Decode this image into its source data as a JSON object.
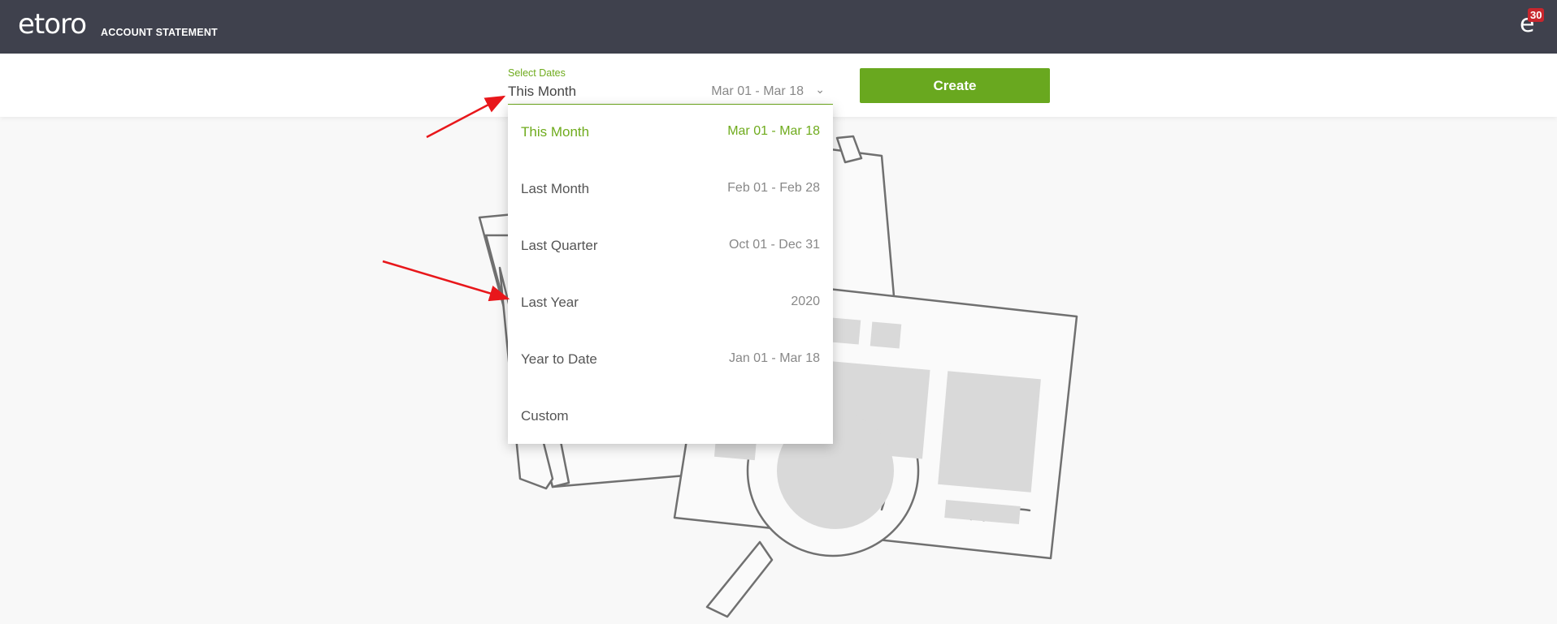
{
  "header": {
    "logo_text": "etoro",
    "title": "ACCOUNT STATEMENT",
    "notification_count": "30",
    "user_avatar_glyph": "e"
  },
  "date_filter": {
    "label": "Select Dates",
    "selected_value": "This Month",
    "selected_range": "Mar 01 - Mar 18",
    "chevron": "⌄"
  },
  "create_button": {
    "label": "Create"
  },
  "dropdown": {
    "options": [
      {
        "label": "This Month",
        "range": "Mar 01 - Mar 18",
        "selected": true
      },
      {
        "label": "Last Month",
        "range": "Feb 01 - Feb 28",
        "selected": false
      },
      {
        "label": "Last Quarter",
        "range": "Oct 01 - Dec 31",
        "selected": false
      },
      {
        "label": "Last Year",
        "range": "2020",
        "selected": false
      },
      {
        "label": "Year to Date",
        "range": "Jan 01 - Mar 18",
        "selected": false
      },
      {
        "label": "Custom",
        "range": "",
        "selected": false
      }
    ]
  },
  "colors": {
    "header_bg": "#3f414d",
    "accent_green": "#6fab1d",
    "button_green": "#69a81f",
    "badge_red": "#c8262d",
    "annotation_arrow": "#e8171b"
  },
  "icons": [
    "etoro-logo-icon",
    "chevron-down-icon",
    "user-avatar-icon",
    "annotation-arrow-icon",
    "statement-illustration-icon"
  ]
}
